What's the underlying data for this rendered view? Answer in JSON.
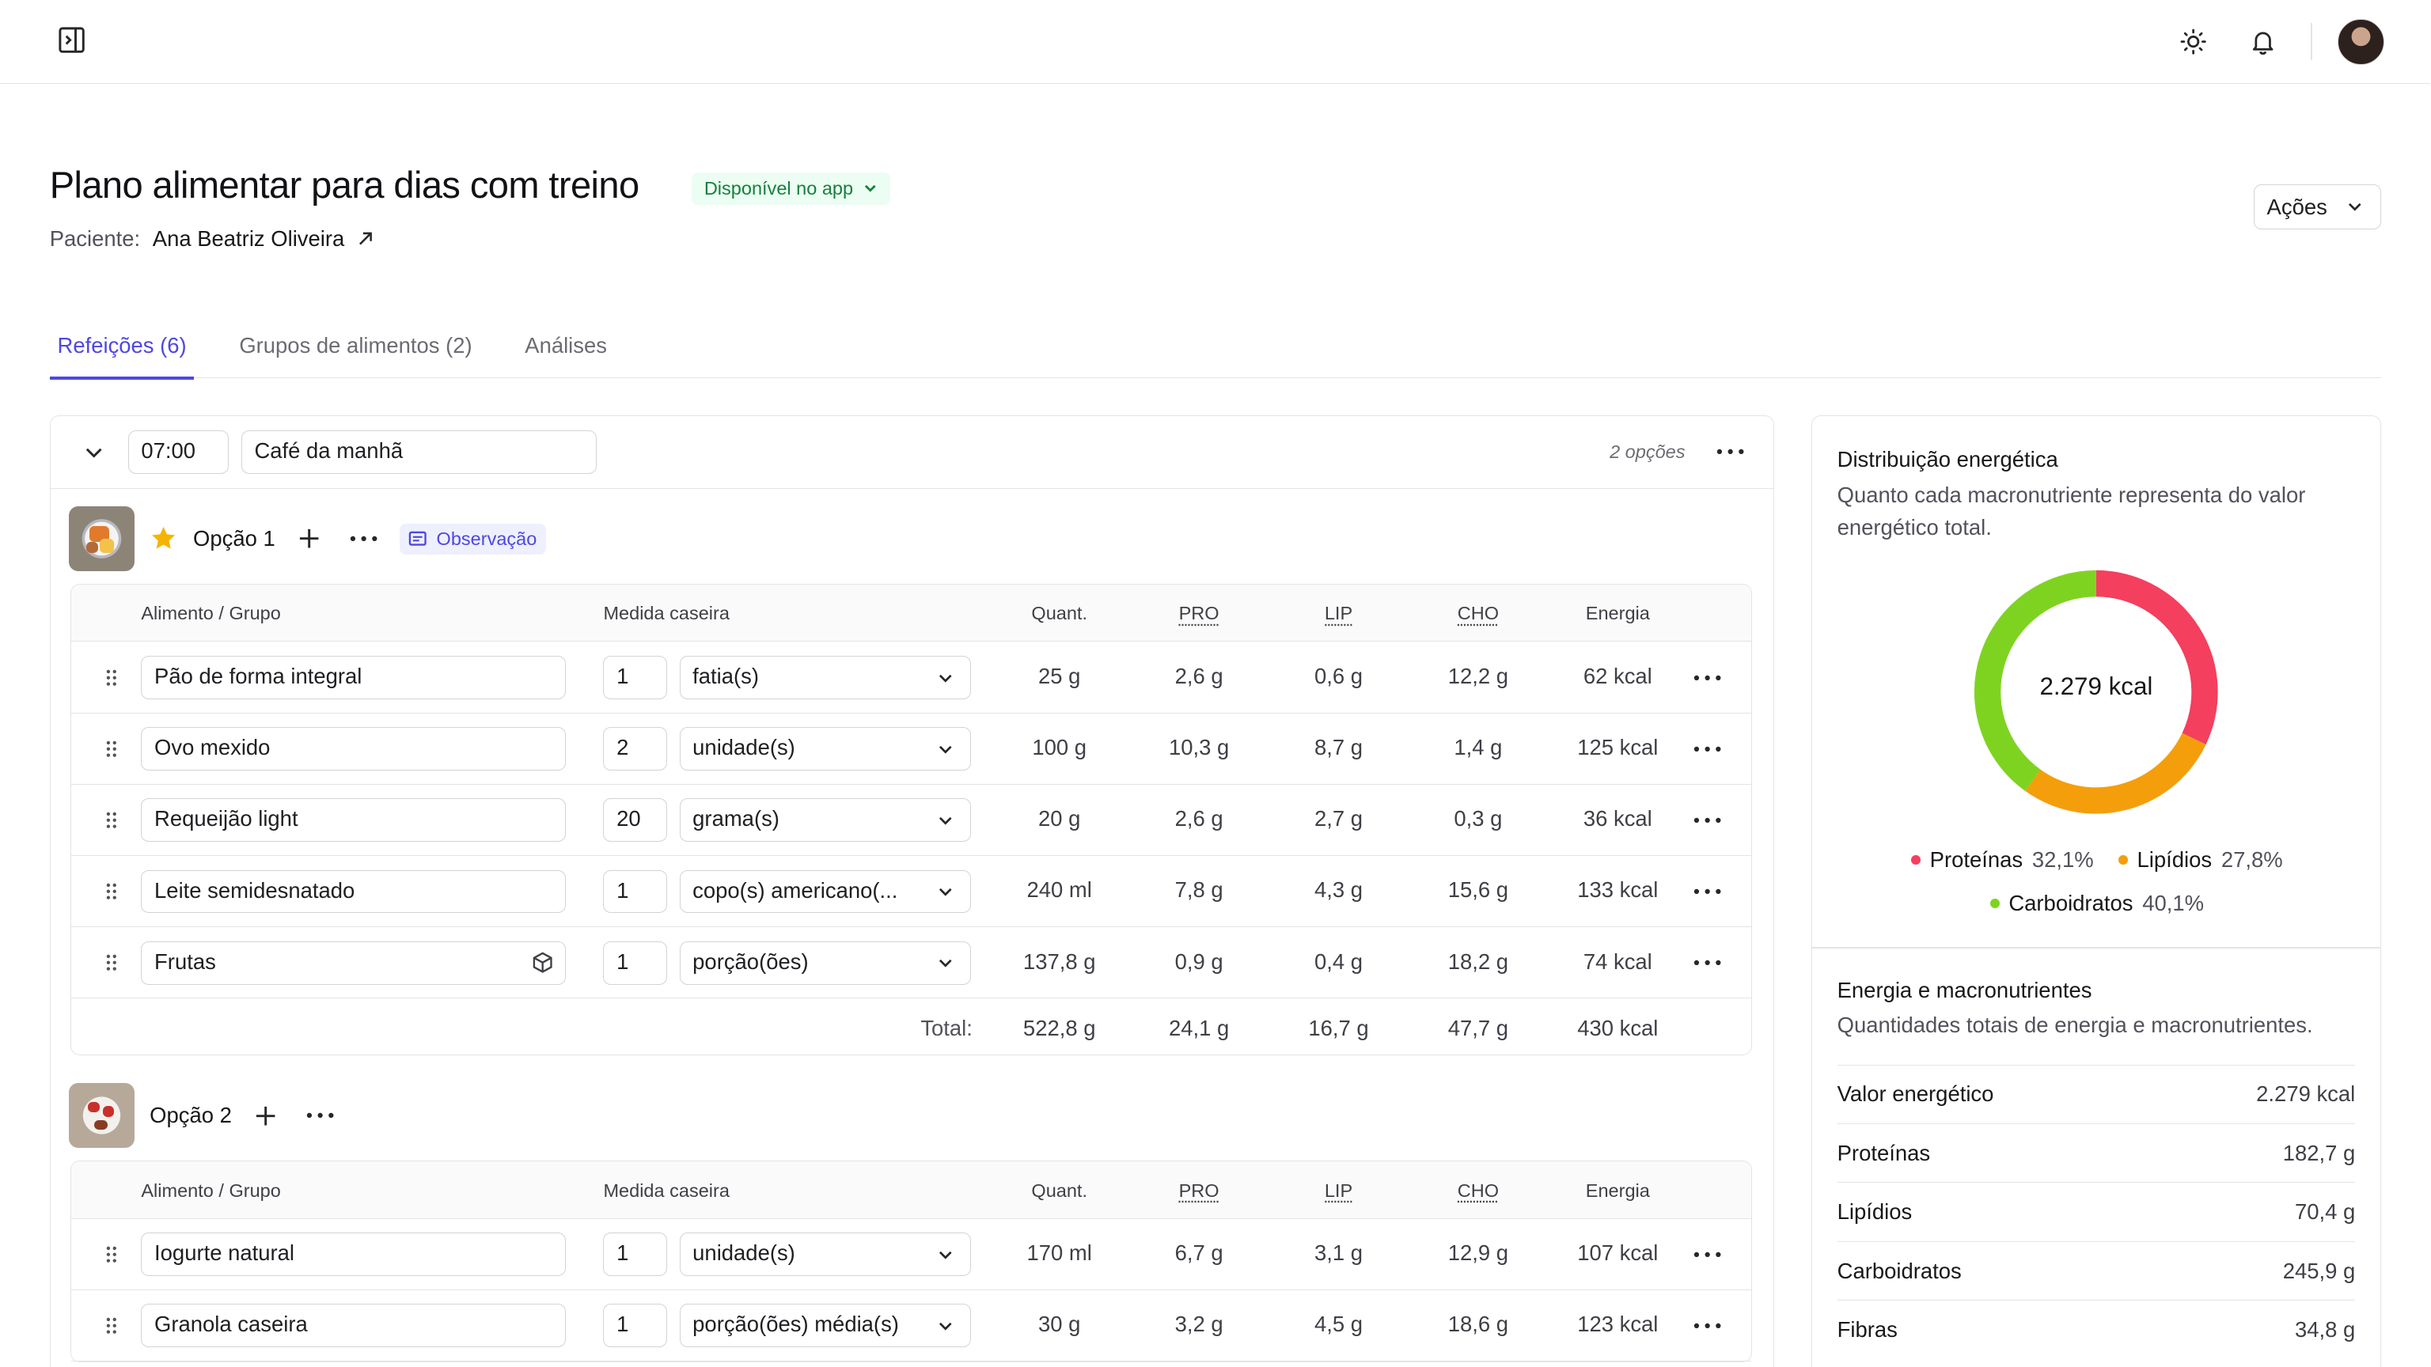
{
  "header": {
    "title": "Plano alimentar para dias com treino",
    "availability_badge": "Disponível no app",
    "patient_label": "Paciente:",
    "patient_name": "Ana Beatriz Oliveira",
    "actions_label": "Ações"
  },
  "tabs": [
    {
      "label": "Refeições (6)",
      "active": true
    },
    {
      "label": "Grupos de alimentos (2)",
      "active": false
    },
    {
      "label": "Análises",
      "active": false
    }
  ],
  "meal": {
    "time": "07:00",
    "name": "Café da manhã",
    "options_count": "2 opções",
    "columns": {
      "food": "Alimento / Grupo",
      "measure": "Medida caseira",
      "quantity": "Quant.",
      "pro": "PRO",
      "lip": "LIP",
      "cho": "CHO",
      "energy": "Energia"
    },
    "option1": {
      "label": "Opção 1",
      "observation_label": "Observação",
      "rows": [
        {
          "food": "Pão de forma integral",
          "qty": "1",
          "unit": "fatia(s)",
          "quant": "25 g",
          "pro": "2,6 g",
          "lip": "0,6 g",
          "cho": "12,2 g",
          "energy": "62 kcal"
        },
        {
          "food": "Ovo mexido",
          "qty": "2",
          "unit": "unidade(s)",
          "quant": "100 g",
          "pro": "10,3 g",
          "lip": "8,7 g",
          "cho": "1,4 g",
          "energy": "125 kcal"
        },
        {
          "food": "Requeijão light",
          "qty": "20",
          "unit": "grama(s)",
          "quant": "20 g",
          "pro": "2,6 g",
          "lip": "2,7 g",
          "cho": "0,3 g",
          "energy": "36 kcal"
        },
        {
          "food": "Leite semidesnatado",
          "qty": "1",
          "unit": "copo(s) americano(...",
          "quant": "240 ml",
          "pro": "7,8 g",
          "lip": "4,3 g",
          "cho": "15,6 g",
          "energy": "133 kcal"
        },
        {
          "food": "Frutas",
          "qty": "1",
          "unit": "porção(ões)",
          "quant": "137,8 g",
          "pro": "0,9 g",
          "lip": "0,4 g",
          "cho": "18,2 g",
          "energy": "74 kcal"
        }
      ],
      "total": {
        "label": "Total:",
        "quant": "522,8 g",
        "pro": "24,1 g",
        "lip": "16,7 g",
        "cho": "47,7 g",
        "energy": "430 kcal"
      }
    },
    "option2": {
      "label": "Opção 2",
      "rows": [
        {
          "food": "Iogurte natural",
          "qty": "1",
          "unit": "unidade(s)",
          "quant": "170 ml",
          "pro": "6,7 g",
          "lip": "3,1 g",
          "cho": "12,9 g",
          "energy": "107 kcal"
        },
        {
          "food": "Granola caseira",
          "qty": "1",
          "unit": "porção(ões) média(s)",
          "quant": "30 g",
          "pro": "3,2 g",
          "lip": "4,5 g",
          "cho": "18,6 g",
          "energy": "123 kcal"
        }
      ]
    }
  },
  "energy_distribution": {
    "title": "Distribuição energética",
    "subtitle": "Quanto cada macronutriente representa do valor energético total.",
    "total": "2.279 kcal",
    "legend": [
      {
        "name": "Proteínas",
        "pct": "32,1%",
        "value": 32.1,
        "color": "#f43f5e"
      },
      {
        "name": "Lipídios",
        "pct": "27,8%",
        "value": 27.8,
        "color": "#f59e0b"
      },
      {
        "name": "Carboidratos",
        "pct": "40,1%",
        "value": 40.1,
        "color": "#7ed321"
      }
    ]
  },
  "macros": {
    "title": "Energia e macronutrientes",
    "subtitle": "Quantidades totais de energia e macronutrientes.",
    "rows": [
      {
        "name": "Valor energético",
        "value": "2.279 kcal"
      },
      {
        "name": "Proteínas",
        "value": "182,7 g"
      },
      {
        "name": "Lipídios",
        "value": "70,4 g"
      },
      {
        "name": "Carboidratos",
        "value": "245,9 g"
      },
      {
        "name": "Fibras",
        "value": "34,8 g"
      }
    ]
  },
  "colors": {
    "accent": "#4f46e5",
    "badge_green": "#15803d",
    "star": "#f5b400"
  },
  "icons": [
    "sidebar-toggle-icon",
    "sun-icon",
    "bell-icon",
    "external-link-icon",
    "chevron-down-icon",
    "star-icon",
    "plus-icon",
    "more-icon",
    "note-icon",
    "drag-handle-icon",
    "cube-icon"
  ]
}
